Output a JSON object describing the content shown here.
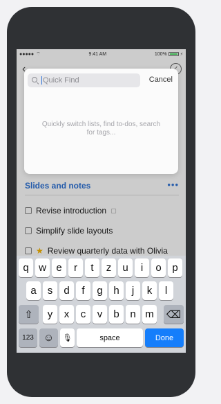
{
  "status_bar": {
    "signal": "●●●●● ",
    "wifi_icon": "wifi-icon",
    "time": "9:41 AM",
    "battery_label": "100%"
  },
  "app": {
    "section_title": "Slides and notes",
    "section_more": "•••",
    "todos": [
      {
        "label": "Revise introduction",
        "has_note": true,
        "starred": false
      },
      {
        "label": "Simplify slide layouts",
        "has_note": false,
        "starred": false
      },
      {
        "label": "Review quarterly data with Olivia",
        "has_note": false,
        "starred": true
      }
    ]
  },
  "quick_find": {
    "placeholder": "Quick Find",
    "value": "",
    "cancel_label": "Cancel",
    "hint": "Quickly switch lists, find to-dos, search for tags..."
  },
  "keyboard": {
    "row1": [
      "q",
      "w",
      "e",
      "r",
      "t",
      "z",
      "u",
      "i",
      "o",
      "p"
    ],
    "row2": [
      "a",
      "s",
      "d",
      "f",
      "g",
      "h",
      "j",
      "k",
      "l"
    ],
    "row3": [
      "y",
      "x",
      "c",
      "v",
      "b",
      "n",
      "m"
    ],
    "numbers_label": "123",
    "space_label": "space",
    "done_label": "Done",
    "shift_glyph": "⇧",
    "delete_glyph": "⌫",
    "emoji_glyph": "☺",
    "mic_glyph": "🎙"
  },
  "colors": {
    "accent": "#2f73d6",
    "done_key": "#157efb",
    "star": "#f5b400"
  }
}
